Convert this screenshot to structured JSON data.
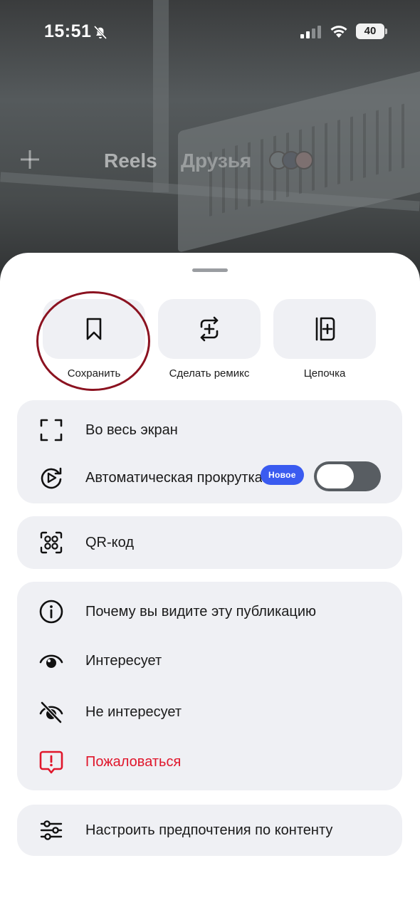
{
  "status_bar": {
    "time": "15:51",
    "battery": "40"
  },
  "background_nav": {
    "tabs": [
      {
        "label": "Reels"
      },
      {
        "label": "Друзья"
      }
    ]
  },
  "quick_actions": [
    {
      "label": "Сохранить",
      "icon": "bookmark-icon"
    },
    {
      "label": "Сделать ремикс",
      "icon": "remix-icon"
    },
    {
      "label": "Цепочка",
      "icon": "sequence-icon"
    }
  ],
  "display_group": {
    "fullscreen_label": "Во весь экран",
    "autoscroll_label": "Автоматическая прокрутка",
    "new_badge": "Новое",
    "autoscroll_enabled": false
  },
  "qr_group": {
    "qr_label": "QR-код"
  },
  "feedback_group": {
    "why_label": "Почему вы видите эту публикацию",
    "interested_label": "Интересует",
    "not_interested_label": "Не интересует",
    "report_label": "Пожаловаться"
  },
  "preferences_group": {
    "preferences_label": "Настроить предпочтения по контенту"
  },
  "colors": {
    "accent_badge": "#3a5bf0",
    "danger": "#e0162b",
    "card_bg": "#eff0f4",
    "annotation_ring": "#8b1220"
  }
}
